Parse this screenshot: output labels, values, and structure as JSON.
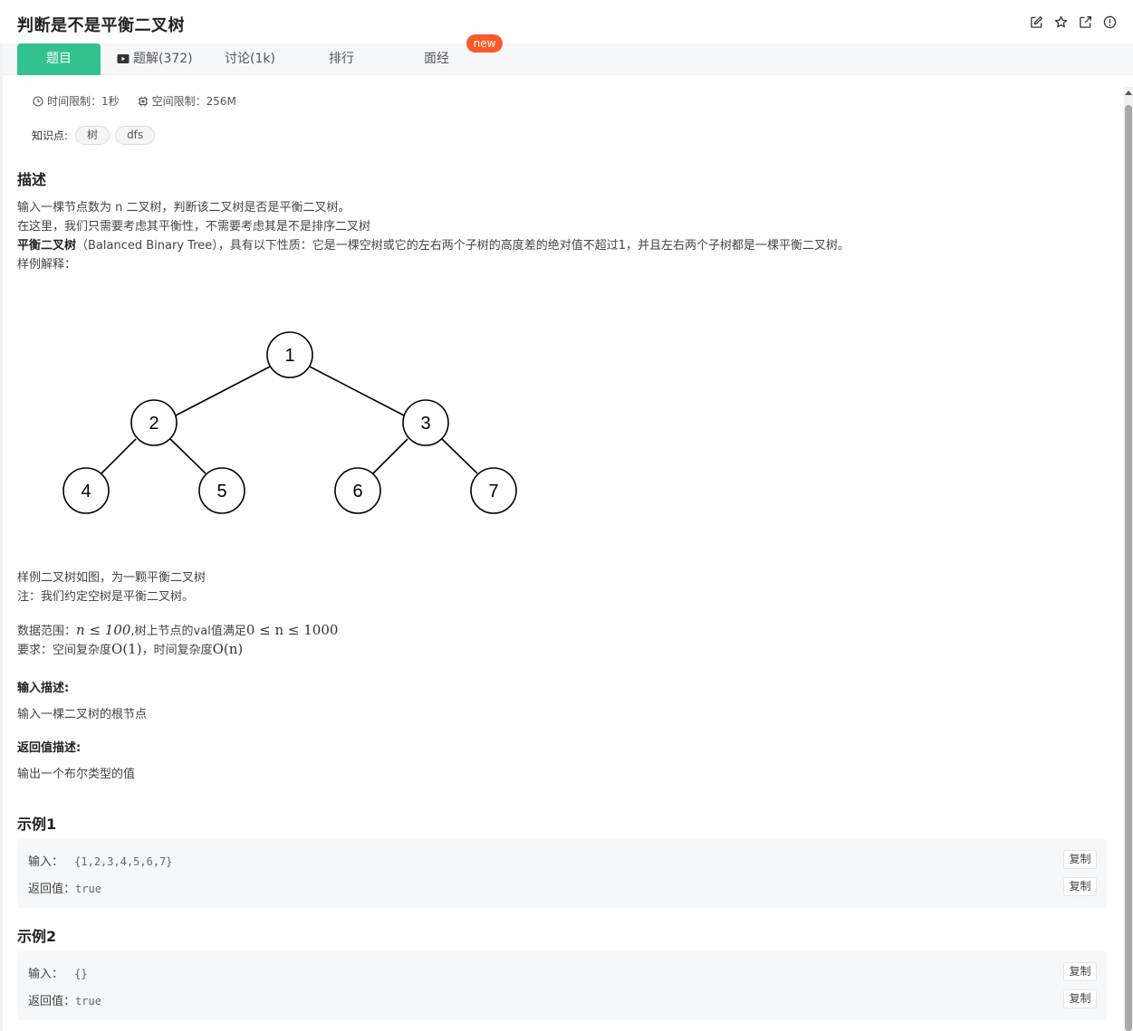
{
  "header": {
    "title": "判断是不是平衡二叉树",
    "icons": [
      "edit-icon",
      "star-icon",
      "external-link-icon",
      "info-icon"
    ]
  },
  "tabs": {
    "problem": "题目",
    "solutions": "题解(372)",
    "discussion": "讨论(1k)",
    "ranking": "排行",
    "interview": "面经",
    "new_badge": "new"
  },
  "limits": {
    "time": "时间限制：1秒",
    "space": "空间限制：256M"
  },
  "knowledge": {
    "label": "知识点:",
    "tags": [
      "树",
      "dfs"
    ]
  },
  "description": {
    "title": "描述",
    "line1": "输入一棵节点数为 n 二叉树，判断该二叉树是否是平衡二叉树。",
    "line2": "在这里，我们只需要考虑其平衡性，不需要考虑其是不是排序二叉树",
    "line3_bold": "平衡二叉树",
    "line3_rest": "（Balanced Binary Tree），具有以下性质：它是一棵空树或它的左右两个子树的高度差的绝对值不超过1，并且左右两个子树都是一棵平衡二叉树。",
    "line4": "样例解释：",
    "after1": "样例二叉树如图，为一颗平衡二叉树",
    "after2": "注：我们约定空树是平衡二叉树。",
    "range_prefix": "数据范围：",
    "range_math1": "n ≤ 100",
    "range_mid": ",树上节点的val值满足",
    "range_math2": "0 ≤ n ≤ 1000",
    "req_prefix": "要求：空间复杂度",
    "req_math1": "O(1)",
    "req_mid": "，时间复杂度",
    "req_math2": "O(n)"
  },
  "tree": {
    "nodes": [
      "1",
      "2",
      "3",
      "4",
      "5",
      "6",
      "7"
    ]
  },
  "input_desc": {
    "title": "输入描述:",
    "text": "输入一棵二叉树的根节点"
  },
  "return_desc": {
    "title": "返回值描述:",
    "text": "输出一个布尔类型的值"
  },
  "examples": [
    {
      "title": "示例1",
      "input_label": "输入：",
      "input_value": "{1,2,3,4,5,6,7}",
      "return_label": "返回值：",
      "return_value": "true",
      "copy": "复制"
    },
    {
      "title": "示例2",
      "input_label": "输入：",
      "input_value": "{}",
      "return_label": "返回值：",
      "return_value": "true",
      "copy": "复制"
    }
  ],
  "colors": {
    "accent": "#32c28f",
    "badge": "#fa5a2a"
  }
}
